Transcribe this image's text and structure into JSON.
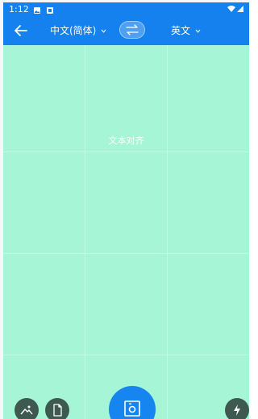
{
  "status_bar": {
    "time": "1:12",
    "icons": [
      "image-icon",
      "notification-icon",
      "wifi-icon",
      "signal-icon"
    ]
  },
  "header": {
    "back_icon": "arrow-left-icon",
    "source_language": "中文(简体)",
    "target_language": "英文",
    "swap_icon": "swap-arrows-icon"
  },
  "viewfinder": {
    "hint": "文本对齐"
  },
  "bottom_controls": {
    "gallery_icon": "image-icon",
    "document_icon": "document-icon",
    "shutter_icon": "camera-shutter-icon",
    "flash_icon": "flash-icon"
  },
  "colors": {
    "primary": "#1481ee",
    "viewfinder": "#a6f5d6",
    "control_bg": "#3e5a50"
  }
}
